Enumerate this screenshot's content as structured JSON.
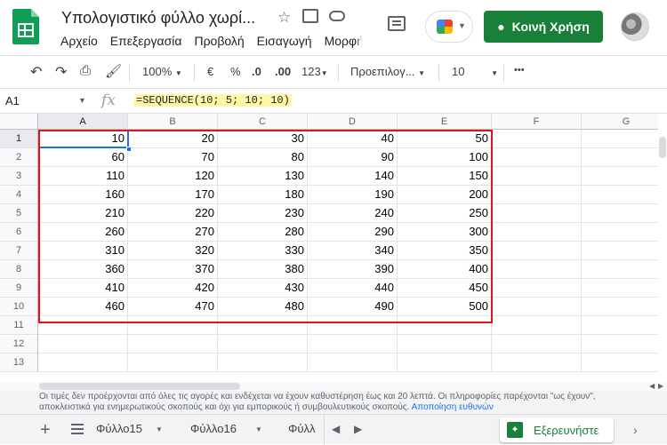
{
  "header": {
    "title": "Υπολογιστικό φύλλο χωρί...",
    "menu": [
      "Αρχείο",
      "Επεξεργασία",
      "Προβολή",
      "Εισαγωγή",
      "Μορφή"
    ],
    "share_label": "Κοινή Χρήση"
  },
  "toolbar": {
    "zoom": "100%",
    "currency": "€",
    "percent": "%",
    "dec_decrease": ".0",
    "dec_increase": ".00",
    "format": "123",
    "font": "Προεπιλογ...",
    "font_size": "10",
    "more": "•••"
  },
  "formula_bar": {
    "cell_ref": "A1",
    "fx": "fx",
    "formula": "=SEQUENCE(10; 5; 10; 10)"
  },
  "grid": {
    "columns": [
      "A",
      "B",
      "C",
      "D",
      "E",
      "F",
      "G"
    ],
    "rows": [
      "1",
      "2",
      "3",
      "4",
      "5",
      "6",
      "7",
      "8",
      "9",
      "10",
      "11",
      "12",
      "13"
    ],
    "cells": [
      [
        "10",
        "20",
        "30",
        "40",
        "50"
      ],
      [
        "60",
        "70",
        "80",
        "90",
        "100"
      ],
      [
        "110",
        "120",
        "130",
        "140",
        "150"
      ],
      [
        "160",
        "170",
        "180",
        "190",
        "200"
      ],
      [
        "210",
        "220",
        "230",
        "240",
        "250"
      ],
      [
        "260",
        "270",
        "280",
        "290",
        "300"
      ],
      [
        "310",
        "320",
        "330",
        "340",
        "350"
      ],
      [
        "360",
        "370",
        "380",
        "390",
        "400"
      ],
      [
        "410",
        "420",
        "430",
        "440",
        "450"
      ],
      [
        "460",
        "470",
        "480",
        "490",
        "500"
      ]
    ]
  },
  "disclaimer": {
    "text": "Οι τιμές δεν προέρχονται από όλες τις αγορές και ενδέχεται να έχουν καθυστέρηση έως και 20 λεπτά. Οι πληροφορίες παρέχονται \"ως έχουν\", αποκλειστικά για ενημερωτικούς σκοπούς και όχι για εμπορικούς ή συμβουλευτικούς σκοπούς.",
    "link": "Αποποίηση ευθυνών"
  },
  "sheets": {
    "tabs": [
      "Φύλλο15",
      "Φύλλο16",
      "Φύλλ"
    ],
    "explore_label": "Εξερευνήστε"
  },
  "colors": {
    "accent_green": "#188038",
    "selection_blue": "#1a73e8",
    "highlight_red": "#e0151b",
    "formula_highlight": "#fdf7a6"
  }
}
